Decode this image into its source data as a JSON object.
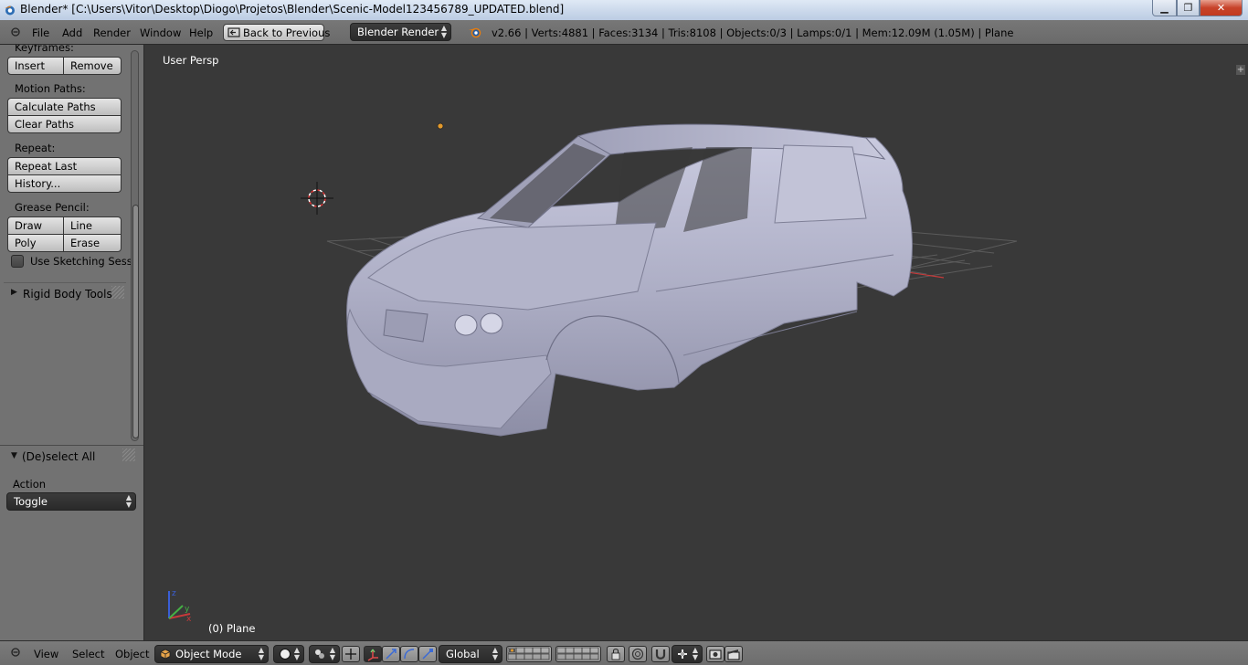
{
  "window": {
    "title": "Blender* [C:\\Users\\Vitor\\Desktop\\Diogo\\Projetos\\Blender\\Scenic-Model123456789_UPDATED.blend]",
    "minimize_glyph": "▁",
    "maximize_glyph": "❐",
    "close_glyph": "✕"
  },
  "info_header": {
    "menus": [
      "File",
      "Add",
      "Render",
      "Window",
      "Help"
    ],
    "back_button": "Back to Previous",
    "render_engine": "Blender Render",
    "stats": "v2.66 | Verts:4881 | Faces:3134 | Tris:8108 | Objects:0/3 | Lamps:0/1 | Mem:12.09M (1.05M) | Plane"
  },
  "tool_shelf": {
    "keyframes": {
      "label": "Keyframes:",
      "insert": "Insert",
      "remove": "Remove"
    },
    "motion_paths": {
      "label": "Motion Paths:",
      "calculate": "Calculate Paths",
      "clear": "Clear Paths"
    },
    "repeat": {
      "label": "Repeat:",
      "last": "Repeat Last",
      "history": "History..."
    },
    "grease_pencil": {
      "label": "Grease Pencil:",
      "draw": "Draw",
      "line": "Line",
      "poly": "Poly",
      "erase": "Erase",
      "sketching": "Use Sketching Sessi",
      "sketching_checked": false
    },
    "rigid_body": {
      "label": "Rigid Body Tools",
      "expanded": false
    }
  },
  "operator_panel": {
    "title": "(De)select All",
    "action_label": "Action",
    "action_value": "Toggle"
  },
  "viewport": {
    "view_name": "User Persp",
    "object_label": "(0) Plane",
    "axis_labels": {
      "x": "x",
      "y": "y",
      "z": "z"
    }
  },
  "bottom_header": {
    "menus": [
      "View",
      "Select",
      "Object"
    ],
    "mode": "Object Mode",
    "orientation": "Global"
  },
  "colors": {
    "background": "#393939",
    "panel": "#727272",
    "header": "#727272",
    "grid": "#555555",
    "x_axis": "#c63a3a",
    "car_body": "#b9bad0",
    "origin": "#e39a2c"
  },
  "icons": [
    "blender-logo-icon",
    "back-icon",
    "render-icon",
    "mode-cube-icon",
    "shading-sphere-icon",
    "pivot-icon",
    "manipulator-icon",
    "layers-icon",
    "lock-icon",
    "snap-icon",
    "camera-icon",
    "clapper-icon"
  ]
}
